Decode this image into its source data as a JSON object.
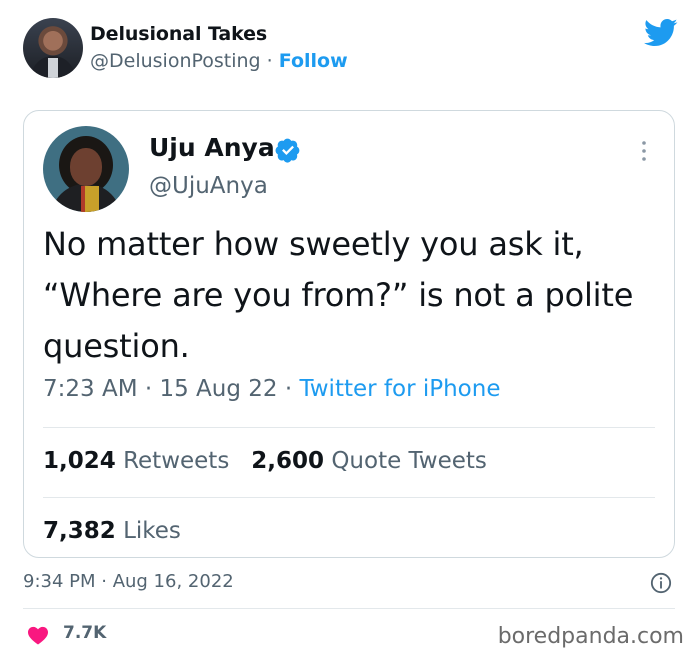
{
  "outer_tweet": {
    "display_name": "Delusional Takes",
    "handle": "@DelusionPosting",
    "separator": "·",
    "follow_label": "Follow",
    "timestamp": "9:34 PM · Aug 16, 2022",
    "like_count": "7.7K"
  },
  "quoted_tweet": {
    "display_name": "Uju Anya",
    "handle": "@UjuAnya",
    "text": "No matter how sweetly you ask it, “Where are you from?” is not a polite question.",
    "time": "7:23 AM",
    "date": "15 Aug 22",
    "dot": "·",
    "source": "Twitter for iPhone",
    "retweets_count": "1,024",
    "retweets_label": "Retweets",
    "quotes_count": "2,600",
    "quotes_label": "Quote Tweets",
    "likes_count": "7,382",
    "likes_label": "Likes"
  },
  "watermark": "boredpanda.com",
  "colors": {
    "accent": "#1d9bf0",
    "heart": "#f91880",
    "text": "#0f1419",
    "muted": "#536471"
  },
  "icons": [
    "twitter-bird-icon",
    "verified-badge-icon",
    "more-options-icon",
    "info-icon",
    "heart-icon"
  ]
}
